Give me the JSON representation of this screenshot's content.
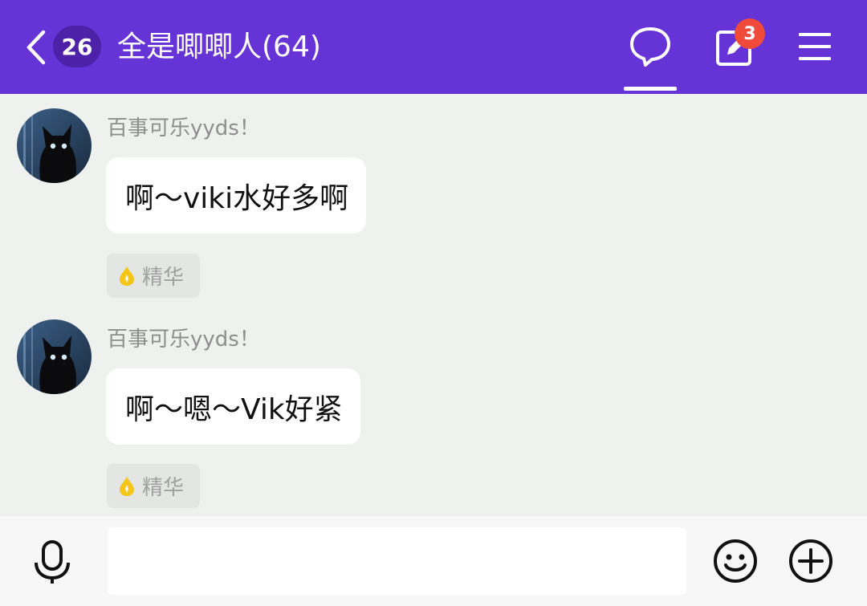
{
  "header": {
    "unread_count": "26",
    "title": "全是唧唧人(64)",
    "notification_count": "3",
    "icons": [
      "back-arrow-icon",
      "chat-bubble-icon",
      "edit-icon",
      "menu-icon"
    ],
    "accent_color": "#6633d6"
  },
  "messages": [
    {
      "sender": "百事可乐yyds！",
      "text": "啊～viki水好多啊",
      "tag": "精华"
    },
    {
      "sender": "百事可乐yyds！",
      "text": "啊～嗯～Vik好紧",
      "tag": "精华"
    }
  ],
  "input_bar": {
    "placeholder": "",
    "icons": [
      "microphone-icon",
      "emoji-icon",
      "plus-icon"
    ]
  }
}
